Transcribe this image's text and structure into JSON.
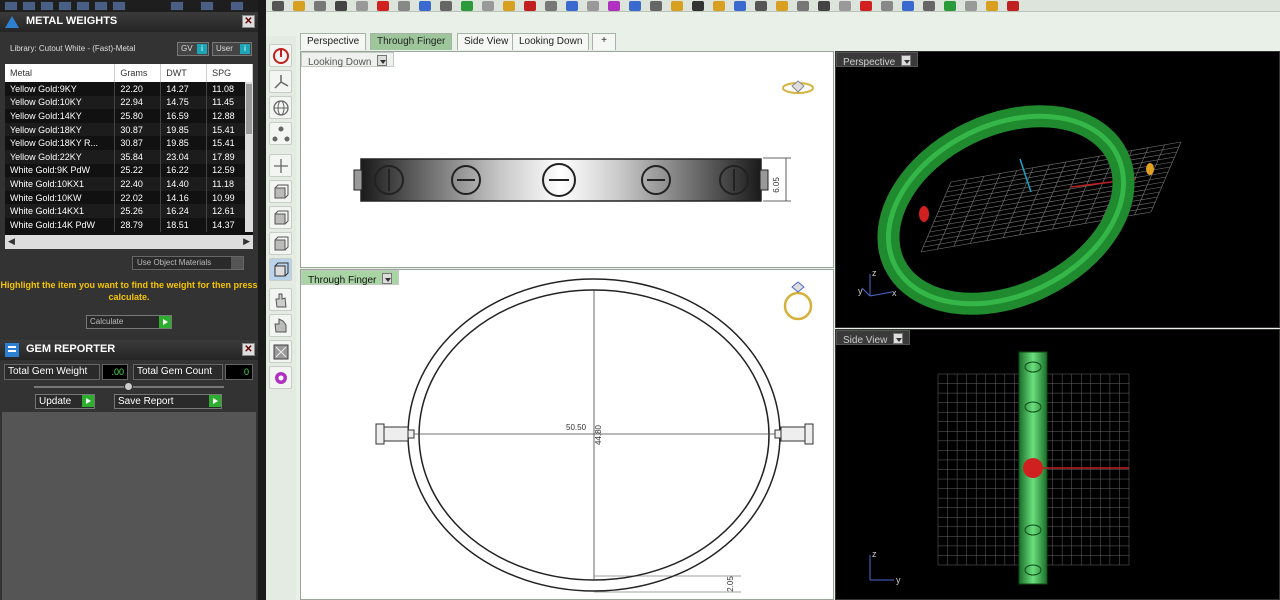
{
  "metal_weights": {
    "title": "METAL WEIGHTS",
    "close": "✕",
    "library": "Library: Cutout White - (Fast)-Metal",
    "gv_label": "GV",
    "user_label": "User",
    "columns": [
      "Metal",
      "Grams",
      "DWT",
      "SPG"
    ],
    "rows": [
      [
        "Yellow Gold:9KY",
        "22.20",
        "14.27",
        "11.08"
      ],
      [
        "Yellow Gold:10KY",
        "22.94",
        "14.75",
        "11.45"
      ],
      [
        "Yellow Gold:14KY",
        "25.80",
        "16.59",
        "12.88"
      ],
      [
        "Yellow Gold:18KY",
        "30.87",
        "19.85",
        "15.41"
      ],
      [
        "Yellow Gold:18KY R...",
        "30.87",
        "19.85",
        "15.41"
      ],
      [
        "Yellow Gold:22KY",
        "35.84",
        "23.04",
        "17.89"
      ],
      [
        "White Gold:9K PdW",
        "25.22",
        "16.22",
        "12.59"
      ],
      [
        "White Gold:10KX1",
        "22.40",
        "14.40",
        "11.18"
      ],
      [
        "White Gold:10KW",
        "22.02",
        "14.16",
        "10.99"
      ],
      [
        "White Gold:14KX1",
        "25.26",
        "16.24",
        "12.61"
      ],
      [
        "White Gold:14K PdW",
        "28.79",
        "18.51",
        "14.37"
      ]
    ],
    "scroll_left": "◀",
    "scroll_right": "▶",
    "use_object_materials": "Use Object Materials",
    "hint": "Highlight the item you want to find the weight for then press calculate.",
    "calculate": "Calculate"
  },
  "gem_reporter": {
    "title": "GEM REPORTER",
    "close": "✕",
    "total_weight_label": "Total Gem Weight",
    "total_weight_value": ".00",
    "total_count_label": "Total Gem Count",
    "total_count_value": "0",
    "update": "Update",
    "save_report": "Save Report"
  },
  "tabs": [
    "Perspective",
    "Through Finger",
    "Side View",
    "Looking Down"
  ],
  "tab_add": "+",
  "active_tab": "Through Finger",
  "viewports": {
    "looking_down": {
      "label": "Looking Down",
      "dim": "6.05"
    },
    "through_finger": {
      "label": "Through Finger",
      "dim_width": "50.50",
      "dim_height": "44.80",
      "dim_small": "2.05"
    },
    "perspective": {
      "label": "Perspective",
      "axis_z": "z",
      "axis_y": "y",
      "axis_x": "x"
    },
    "side_view": {
      "label": "Side View",
      "axis_z": "z",
      "axis_y": "y"
    }
  },
  "colors": {
    "accent_green": "#2e9e3e",
    "hint_yellow": "#f5c400",
    "active_tab": "#9dc79a"
  }
}
